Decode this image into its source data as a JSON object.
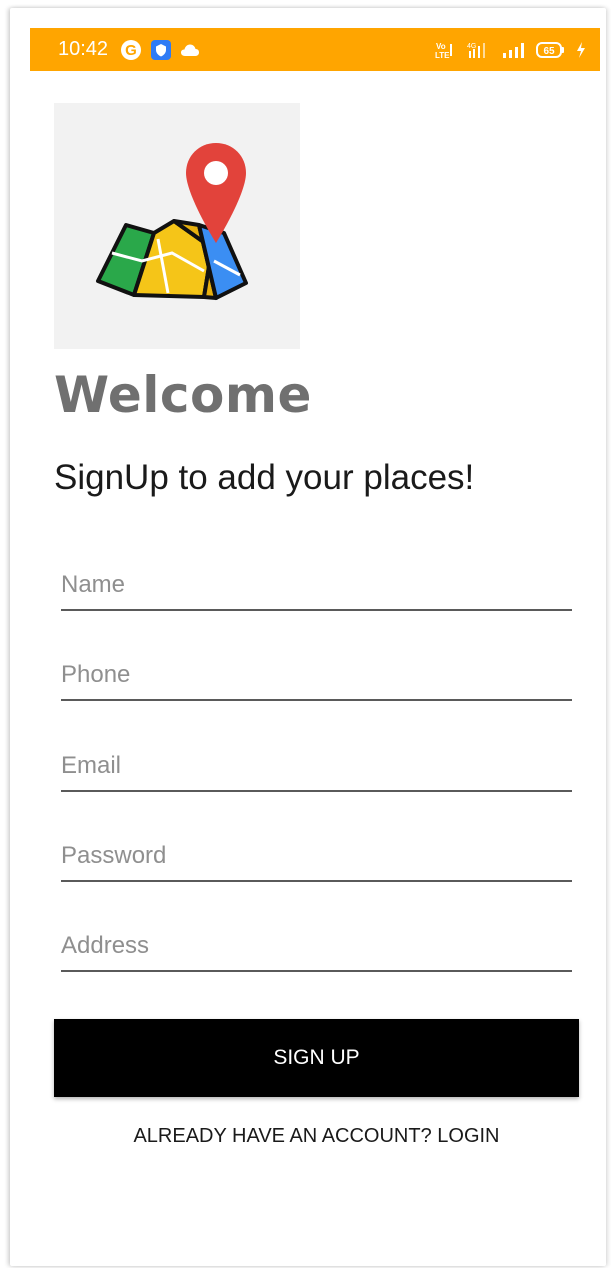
{
  "status_bar": {
    "time": "10:42",
    "battery": "65",
    "bg_color": "#FFA500",
    "left_icons": [
      "google-icon",
      "vpn-shield-icon",
      "cloud-icon"
    ],
    "right_icons": [
      "volte-icon",
      "4g-signal-icon",
      "signal-bars-icon",
      "battery-icon",
      "charging-bolt-icon"
    ]
  },
  "logo": {
    "icon": "map-pin-logo"
  },
  "header": {
    "title": "Welcome",
    "subtitle": "SignUp to add your places!"
  },
  "form": {
    "name_placeholder": "Name",
    "phone_placeholder": "Phone",
    "email_placeholder": "Email",
    "password_placeholder": "Password",
    "address_placeholder": "Address",
    "name_value": "",
    "phone_value": "",
    "email_value": "",
    "password_value": "",
    "address_value": ""
  },
  "actions": {
    "signup_label": "SIGN UP",
    "login_label": "ALREADY HAVE AN ACCOUNT? LOGIN"
  }
}
